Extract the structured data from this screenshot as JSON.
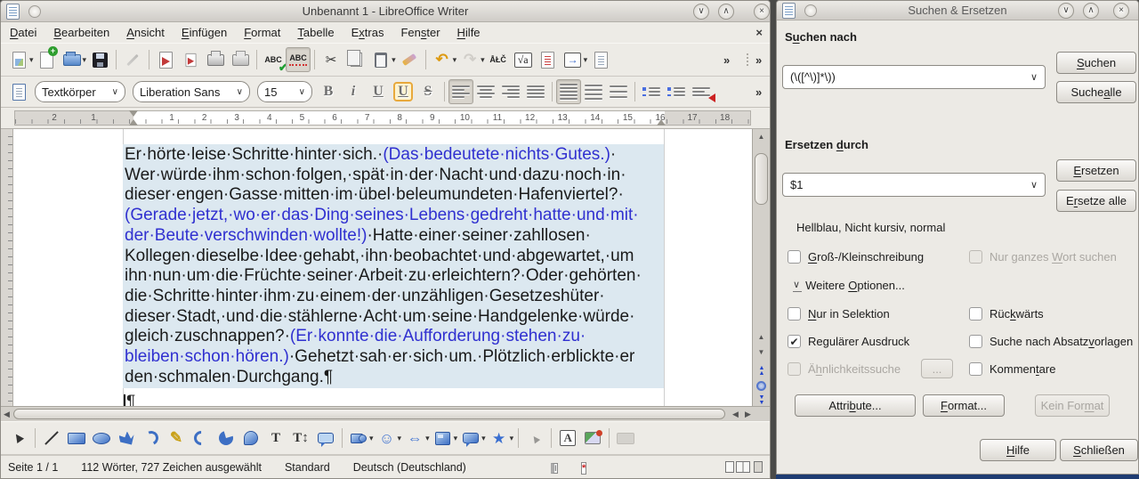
{
  "colors": {
    "selection_bg": "#dce8f0",
    "match_text_blue": "#3030d0",
    "window_bg": "#edebe6",
    "dialog_bg": "#eceae5",
    "accent_nav_blue": "#2244cc",
    "modified_red": "#cc2222",
    "pressed_bg": "#d9d5cd"
  },
  "icons": {
    "cut": "✂",
    "undo": "↶",
    "redo": "↷",
    "special_character": "ÅŁČ",
    "formula": "√a",
    "dropdown": "▾",
    "combo_arrow": "∨",
    "overflow": "»",
    "expander": "∨",
    "smiley": "☺",
    "double_arrow": "⇔",
    "star": "★",
    "pencil": "✎",
    "check": "✔",
    "close": "×",
    "win_shade": "∨",
    "win_unshade": "∧",
    "pilcrow": "¶",
    "modified": "*",
    "up": "▲",
    "down": "▼",
    "left": "◀",
    "right": "▶",
    "navigator_arrow": "→",
    "text_tool": "T",
    "vertical_text_tool": "T↕",
    "fontwork": "A",
    "selection_mode": "I",
    "bold": "B",
    "italic": "i",
    "underline": "U",
    "double_underline": "U",
    "strikethrough": "S"
  },
  "writer": {
    "title": "Unbenannt 1 - LibreOffice Writer",
    "menu": {
      "items": [
        {
          "label": "Datei",
          "key": "D"
        },
        {
          "label": "Bearbeiten",
          "key": "B"
        },
        {
          "label": "Ansicht",
          "key": "A"
        },
        {
          "label": "Einfügen",
          "key": "E"
        },
        {
          "label": "Format",
          "key": "F"
        },
        {
          "label": "Tabelle",
          "key": "T"
        },
        {
          "label": "Extras",
          "key": "x"
        },
        {
          "label": "Fenster",
          "key": "s"
        },
        {
          "label": "Hilfe",
          "key": "H"
        }
      ]
    },
    "format_toolbar": {
      "paragraph_style": "Textkörper",
      "font_name": "Liberation Sans",
      "font_size": "15"
    },
    "ruler": {
      "left_numbers": [
        "2",
        "1"
      ],
      "numbers": [
        "1",
        "2",
        "3",
        "4",
        "5",
        "6",
        "7",
        "8",
        "9",
        "10",
        "11",
        "12",
        "13",
        "14",
        "15",
        "16"
      ],
      "right_numbers": [
        "17",
        "18"
      ]
    },
    "document": {
      "lines": [
        [
          {
            "t": "Er·hörte·leise·Schritte·hinter·sich.·",
            "c": "k"
          },
          {
            "t": "(Das·bedeutete·nichts·Gutes.)",
            "c": "b"
          },
          {
            "t": "·",
            "c": "k"
          }
        ],
        [
          {
            "t": "Wer·würde·ihm·schon·folgen,·spät·in·der·Nacht·und·dazu·noch·in·",
            "c": "k"
          }
        ],
        [
          {
            "t": "dieser·engen·Gasse·mitten·im·übel·beleumundeten·Hafenviertel?·",
            "c": "k"
          }
        ],
        [
          {
            "t": "(Gerade·jetzt,·wo·er·das·Ding·seines·Lebens·gedreht·hatte·und·mit·",
            "c": "b"
          }
        ],
        [
          {
            "t": "der·Beute·verschwinden·wollte!)",
            "c": "b"
          },
          {
            "t": "·Hatte·einer·seiner·zahllosen·",
            "c": "k"
          }
        ],
        [
          {
            "t": "Kollegen·dieselbe·Idee·gehabt,·ihn·beobachtet·und·abgewartet,·um",
            "c": "k"
          }
        ],
        [
          {
            "t": "ihn·nun·um·die·Früchte·seiner·Arbeit·zu·erleichtern?·Oder·gehörten·",
            "c": "k"
          }
        ],
        [
          {
            "t": "die·Schritte·hinter·ihm·zu·einem·der·unzähligen·Gesetzeshüter·",
            "c": "k"
          }
        ],
        [
          {
            "t": "dieser·Stadt,·und·die·stählerne·Acht·um·seine·Handgelenke·würde·",
            "c": "k"
          }
        ],
        [
          {
            "t": "gleich·zuschnappen?·",
            "c": "k"
          },
          {
            "t": "(Er·konnte·die·Aufforderung·stehen·zu·",
            "c": "b"
          }
        ],
        [
          {
            "t": "bleiben·schon·hören.)",
            "c": "b"
          },
          {
            "t": "·Gehetzt·sah·er·sich·um.·Plötzlich·erblickte·er",
            "c": "k"
          }
        ],
        [
          {
            "t": "den·schmalen·Durchgang.¶",
            "c": "k"
          }
        ]
      ],
      "caret_pilcrow": "¶"
    },
    "statusbar": {
      "page": "Seite 1 / 1",
      "words": "112 Wörter, 727 Zeichen ausgewählt",
      "style": "Standard",
      "language": "Deutsch (Deutschland)"
    }
  },
  "dialog": {
    "title": "Suchen & Ersetzen",
    "search": {
      "label": {
        "text": "Suchen nach",
        "key": "u"
      },
      "value": "(\\([^\\)]*\\))"
    },
    "replace": {
      "label": {
        "text": "Ersetzen durch",
        "key": "d"
      },
      "value": "$1",
      "format_hint": "Hellblau, Nicht kursiv, normal"
    },
    "buttons": {
      "search": {
        "text": "Suchen",
        "key": "S"
      },
      "search_all": {
        "text": "Suche alle",
        "key": "a"
      },
      "replace": {
        "text": "Ersetzen",
        "key": "E"
      },
      "replace_all": {
        "text": "Ersetze alle",
        "key": "r"
      },
      "attributes": {
        "text": "Attribute...",
        "key": "b"
      },
      "format": {
        "text": "Format...",
        "key": "F"
      },
      "no_format": {
        "text": "Kein Format",
        "key": "m"
      },
      "help": {
        "text": "Hilfe",
        "key": "H"
      },
      "close": {
        "text": "Schließen",
        "key": "S"
      },
      "similarity_dots": "..."
    },
    "options": {
      "match_case": {
        "text": "Groß-/Kleinschreibung",
        "key": "G"
      },
      "whole_words": {
        "text": "Nur ganzes Wort suchen",
        "key": "W"
      },
      "more_options": {
        "text": "Weitere Optionen...",
        "key": "O"
      },
      "selection_only": {
        "text": "Nur in Selektion",
        "key": "N"
      },
      "backwards": {
        "text": "Rückwärts",
        "key": "k"
      },
      "regex": {
        "text": "Regulärer Ausdruck",
        "key": ""
      },
      "paragraph_styles": {
        "text": "Suche nach Absatzvorlagen",
        "key": "v"
      },
      "similarity": {
        "text": "Ähnlichkeitssuche",
        "key": "h"
      },
      "comments": {
        "text": "Kommentare",
        "key": "t"
      }
    }
  }
}
